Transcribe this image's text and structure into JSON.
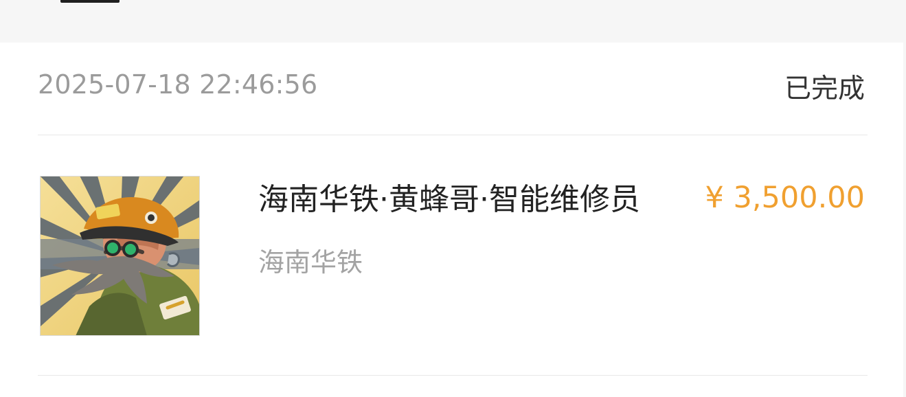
{
  "order": {
    "datetime": "2025-07-18 22:46:56",
    "status": "已完成"
  },
  "item": {
    "title": "海南华铁·黄蜂哥·智能维修员",
    "shop": "海南华铁",
    "price": "¥ 3,500.00",
    "thumbnail_icon": "mechanic-avatar-image"
  },
  "colors": {
    "price": "#f0a030",
    "status_text": "#333333",
    "meta_text": "#9b9b9b",
    "page_bg": "#f6f6f6",
    "card_bg": "#ffffff"
  }
}
